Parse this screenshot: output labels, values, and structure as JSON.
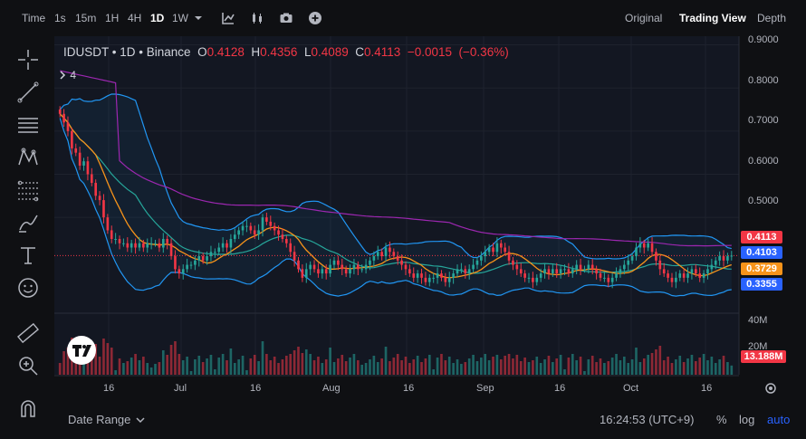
{
  "toolbar": {
    "time_label": "Time",
    "intervals": [
      "1s",
      "15m",
      "1H",
      "4H",
      "1D",
      "1W"
    ],
    "active_interval": "1D",
    "views": [
      "Original",
      "Trading View",
      "Depth"
    ],
    "active_view": "Trading View"
  },
  "legend": {
    "symbol": "IDUSDT",
    "interval": "1D",
    "exchange": "Binance",
    "open_label": "O",
    "open": "0.4128",
    "high_label": "H",
    "high": "0.4356",
    "low_label": "L",
    "low": "0.4089",
    "close_label": "C",
    "close": "0.4113",
    "change": "−0.0015",
    "change_pct": "(−0.36%)",
    "indicator_count": "4"
  },
  "price_tags": [
    {
      "label": "0.4113",
      "color": "#f23645"
    },
    {
      "label": "0.4103",
      "color": "#2962ff"
    },
    {
      "label": "0.3729",
      "color": "#f7931a"
    },
    {
      "label": "0.3355",
      "color": "#2962ff"
    }
  ],
  "volume_axis": [
    "40M",
    "20M"
  ],
  "volume_tag": {
    "label": "13.188M",
    "color": "#f23645"
  },
  "bottom_bar": {
    "date_range": "Date Range",
    "clock": "16:24:53 (UTC+9)",
    "percent": "%",
    "log": "log",
    "auto": "auto"
  },
  "colors": {
    "up": "#26a69a",
    "down": "#f23645",
    "ma_short": "#f7931a",
    "ma_mid": "#26a69a",
    "ma_long": "#9c27b0",
    "bollinger": "#2196f3"
  },
  "chart_data": {
    "type": "candlestick",
    "symbol": "IDUSDT",
    "y_ticks": [
      "0.9000",
      "0.8000",
      "0.7000",
      "0.6000",
      "0.5000"
    ],
    "ylim": [
      0.28,
      0.92
    ],
    "x_ticks": [
      "16",
      "Jul",
      "16",
      "Aug",
      "16",
      "Sep",
      "16",
      "Oct",
      "16"
    ],
    "grid": true,
    "closes": [
      0.74,
      0.72,
      0.7,
      0.66,
      0.65,
      0.62,
      0.63,
      0.6,
      0.58,
      0.55,
      0.54,
      0.5,
      0.47,
      0.45,
      0.45,
      0.44,
      0.44,
      0.43,
      0.44,
      0.43,
      0.44,
      0.43,
      0.44,
      0.44,
      0.44,
      0.43,
      0.45,
      0.44,
      0.41,
      0.38,
      0.37,
      0.38,
      0.39,
      0.39,
      0.4,
      0.41,
      0.4,
      0.41,
      0.42,
      0.42,
      0.43,
      0.44,
      0.43,
      0.45,
      0.46,
      0.47,
      0.48,
      0.48,
      0.47,
      0.46,
      0.47,
      0.5,
      0.49,
      0.48,
      0.47,
      0.46,
      0.45,
      0.44,
      0.42,
      0.4,
      0.38,
      0.36,
      0.38,
      0.39,
      0.38,
      0.37,
      0.38,
      0.37,
      0.39,
      0.4,
      0.39,
      0.38,
      0.37,
      0.38,
      0.39,
      0.38,
      0.38,
      0.39,
      0.4,
      0.41,
      0.42,
      0.41,
      0.43,
      0.42,
      0.41,
      0.4,
      0.39,
      0.38,
      0.37,
      0.36,
      0.37,
      0.36,
      0.35,
      0.36,
      0.36,
      0.37,
      0.36,
      0.35,
      0.36,
      0.37,
      0.38,
      0.38,
      0.37,
      0.38,
      0.39,
      0.4,
      0.41,
      0.42,
      0.43,
      0.42,
      0.44,
      0.43,
      0.42,
      0.4,
      0.39,
      0.38,
      0.37,
      0.36,
      0.36,
      0.35,
      0.36,
      0.37,
      0.38,
      0.37,
      0.38,
      0.37,
      0.38,
      0.38,
      0.37,
      0.38,
      0.39,
      0.38,
      0.38,
      0.39,
      0.38,
      0.37,
      0.36,
      0.36,
      0.35,
      0.36,
      0.37,
      0.38,
      0.39,
      0.4,
      0.41,
      0.43,
      0.44,
      0.43,
      0.44,
      0.42,
      0.4,
      0.38,
      0.37,
      0.36,
      0.35,
      0.36,
      0.37,
      0.36,
      0.37,
      0.38,
      0.37,
      0.36,
      0.37,
      0.38,
      0.39,
      0.4,
      0.41,
      0.4,
      0.41,
      0.4113
    ],
    "ma_short_last": 0.3729,
    "ma_mid_last": 0.4103,
    "bollinger_lower_last": 0.3355
  }
}
